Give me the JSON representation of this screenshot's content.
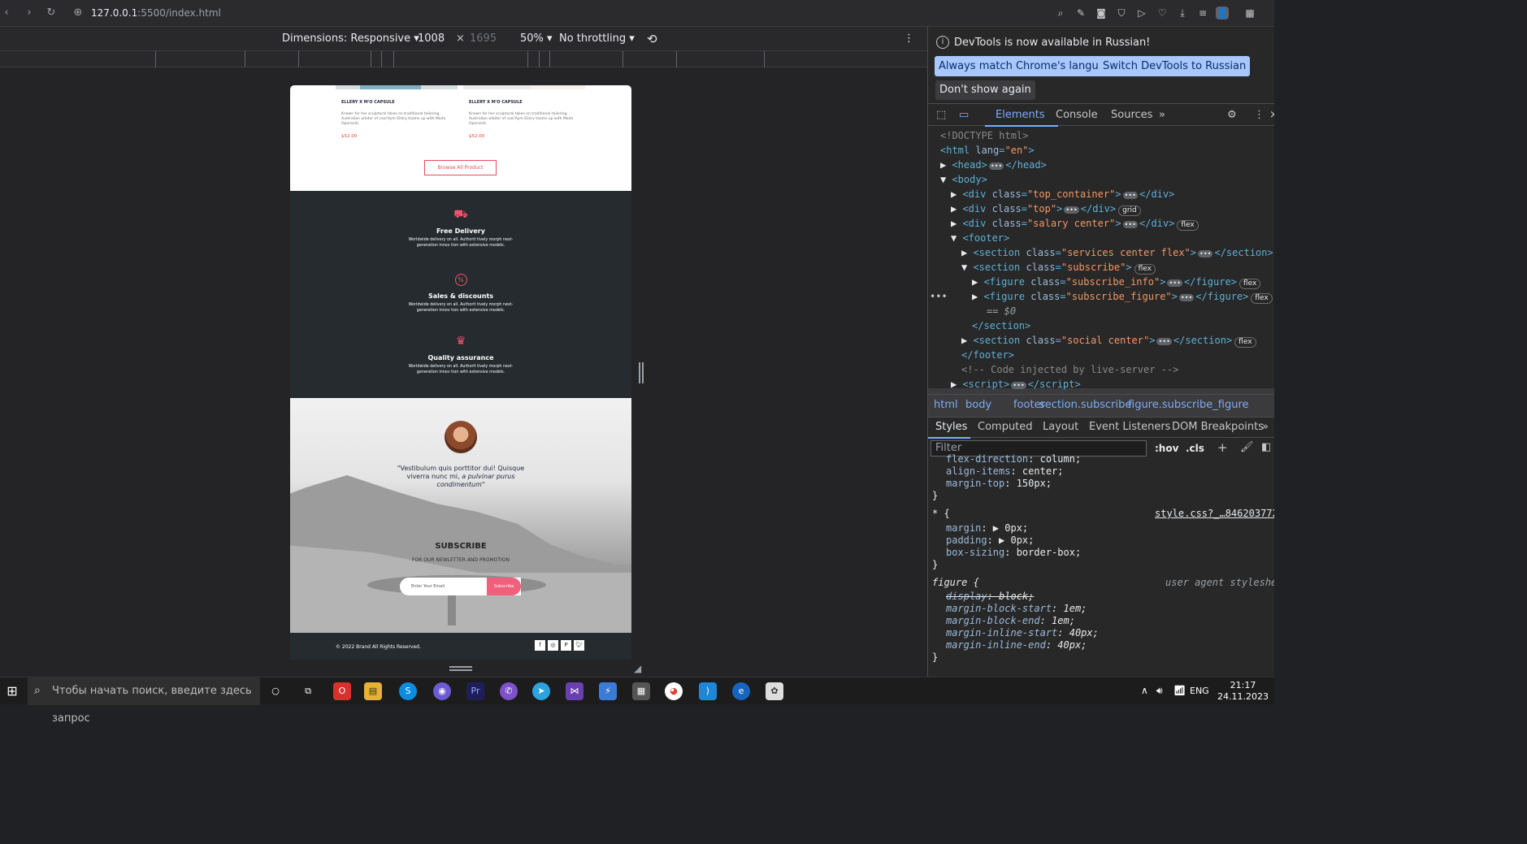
{
  "browser": {
    "url_host": "127.0.0.1",
    "url_rest": ":5500/index.html"
  },
  "emulation": {
    "dimensions": "Dimensions: Responsive",
    "width": "1008",
    "height": "1695",
    "zoom": "50%",
    "throttling": "No throttling"
  },
  "products": [
    {
      "title": "ELLERY X M'O CAPSULE",
      "desc": "Known for her sculptural takes on traditional tailoring, Australian arbiter of cool Kym Ellery teams up with Moda Operandi.",
      "price": "$52.00"
    },
    {
      "title": "ELLERY X M'O CAPSULE",
      "desc": "Known for her sculptural takes on traditional tailoring, Australian arbiter of cool Kym Ellery teams up with Moda Operandi.",
      "price": "$52.00"
    }
  ],
  "browse_label": "Browse All Product",
  "services": [
    {
      "icon": "truck-icon",
      "glyph": "⛟",
      "title": "Free Delivery",
      "desc": "Worldwide delivery on all. Authorit tively morph next-generation innov tion with extensive models."
    },
    {
      "icon": "percent-icon",
      "glyph": "%",
      "title": "Sales & discounts",
      "desc": "Worldwide delivery on all. Authorit tively morph next-generation innov tion with extensive models."
    },
    {
      "icon": "crown-icon",
      "glyph": "♛",
      "title": "Quality assurance",
      "desc": "Worldwide delivery on all. Authorit tively morph next-generation innov tion with extensive models."
    }
  ],
  "subscribe": {
    "quote_main": "\"Vestibulum quis porttitor dui! Quisque viverra nunc mi, ",
    "quote_italic": "a pulvinar purus condimentum\"",
    "title": "SUBSCRIBE",
    "subtitle": "FOR OUR NEWLETTER AND PROMOTION",
    "placeholder": "Enter Your Email",
    "button": "Subscribe"
  },
  "footer": {
    "copyright": "© 2022 Brand All Rights Reserved."
  },
  "devtools": {
    "info": "DevTools is now available in Russian!",
    "btn_match": "Always match Chrome's language",
    "btn_switch": "Switch DevTools to Russian",
    "btn_dont": "Don't show again",
    "tabs": [
      "Elements",
      "Console",
      "Sources"
    ],
    "crumbs": [
      "html",
      "body",
      "footer",
      "section.subscribe",
      "figure.subscribe_figure"
    ],
    "style_tabs": [
      "Styles",
      "Computed",
      "Layout",
      "Event Listeners",
      "DOM Breakpoints"
    ],
    "filter_placeholder": "Filter",
    "hov": ":hov",
    "cls": ".cls",
    "stylesheet": "style.css?_…846203772",
    "ua": "user agent styleshee",
    "selected_eq": "== $0"
  },
  "taskbar": {
    "search_placeholder": "Чтобы начать поиск, введите здесь запрос",
    "lang": "ENG",
    "time": "21:17",
    "date": "24.11.2023"
  }
}
